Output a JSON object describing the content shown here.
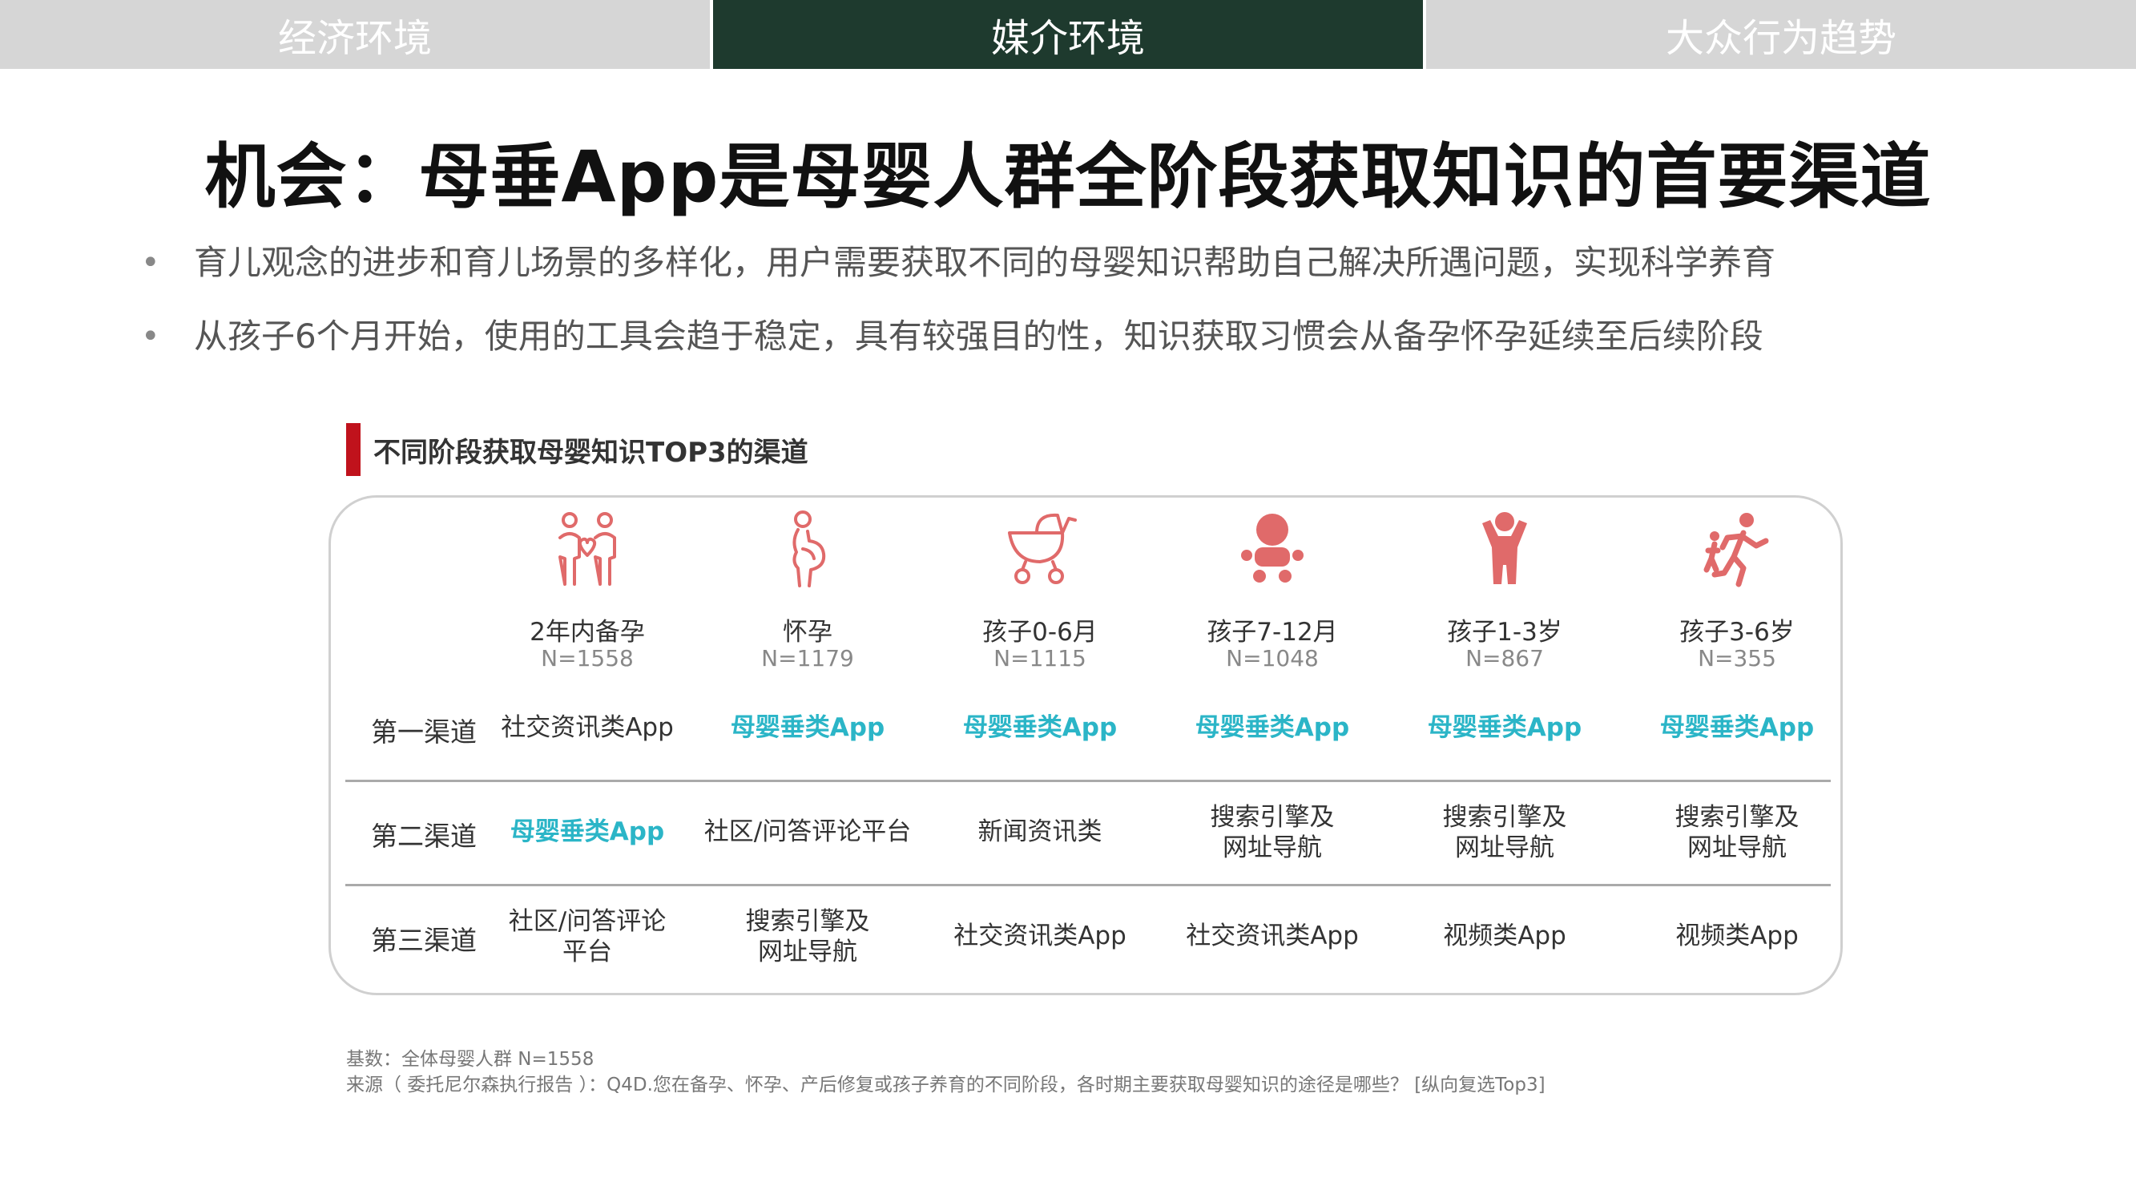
{
  "tabs": [
    {
      "label": "经济环境",
      "active": false
    },
    {
      "label": "媒介环境",
      "active": true
    },
    {
      "label": "大众行为趋势",
      "active": false
    }
  ],
  "title": "机会：母垂App是母婴人群全阶段获取知识的首要渠道",
  "bullets": [
    "育儿观念的进步和育儿场景的多样化，用户需要获取不同的母婴知识帮助自己解决所遇问题，实现科学养育",
    "从孩子6个月开始，使用的工具会趋于稳定，具有较强目的性，知识获取习惯会从备孕怀孕延续至后续阶段"
  ],
  "section_title": "不同阶段获取母婴知识TOP3的渠道",
  "stages": [
    {
      "name": "2年内备孕",
      "n": "N=1558",
      "icon": "couple-heart-icon"
    },
    {
      "name": "怀孕",
      "n": "N=1179",
      "icon": "pregnant-woman-icon"
    },
    {
      "name": "孩子0-6月",
      "n": "N=1115",
      "icon": "baby-stroller-icon"
    },
    {
      "name": "孩子7-12月",
      "n": "N=1048",
      "icon": "baby-crawling-icon"
    },
    {
      "name": "孩子1-3岁",
      "n": "N=867",
      "icon": "toddler-icon"
    },
    {
      "name": "孩子3-6岁",
      "n": "N=355",
      "icon": "running-child-icon"
    }
  ],
  "rows": [
    {
      "label": "第一渠道",
      "cells": [
        {
          "text": "社交资讯类App",
          "highlight": false
        },
        {
          "text": "母婴垂类App",
          "highlight": true
        },
        {
          "text": "母婴垂类App",
          "highlight": true
        },
        {
          "text": "母婴垂类App",
          "highlight": true
        },
        {
          "text": "母婴垂类App",
          "highlight": true
        },
        {
          "text": "母婴垂类App",
          "highlight": true
        }
      ]
    },
    {
      "label": "第二渠道",
      "cells": [
        {
          "text": "母婴垂类App",
          "highlight": true
        },
        {
          "text": "社区/问答评论平台",
          "highlight": false
        },
        {
          "text": "新闻资讯类",
          "highlight": false
        },
        {
          "text": "搜索引擎及\n网址导航",
          "highlight": false
        },
        {
          "text": "搜索引擎及\n网址导航",
          "highlight": false
        },
        {
          "text": "搜索引擎及\n网址导航",
          "highlight": false
        }
      ]
    },
    {
      "label": "第三渠道",
      "cells": [
        {
          "text": "社区/问答评论\n平台",
          "highlight": false
        },
        {
          "text": "搜索引擎及\n网址导航",
          "highlight": false
        },
        {
          "text": "社交资讯类App",
          "highlight": false
        },
        {
          "text": "社交资讯类App",
          "highlight": false
        },
        {
          "text": "视频类App",
          "highlight": false
        },
        {
          "text": "视频类App",
          "highlight": false
        }
      ]
    }
  ],
  "footnotes": [
    "基数：全体母婴人群 N=1558",
    "来源（  委托尼尔森执行报告  ）：Q4D.您在备孕、怀孕、产后修复或孩子养育的不同阶段，各时期主要获取母婴知识的途径是哪些？ [纵向复选Top3]"
  ],
  "colors": {
    "accent_red": "#c0121c",
    "highlight_teal": "#2bb5c7",
    "active_tab": "#1e3a2e",
    "inactive_tab": "#d6d6d6",
    "icon_pink": "#e06a6a"
  }
}
